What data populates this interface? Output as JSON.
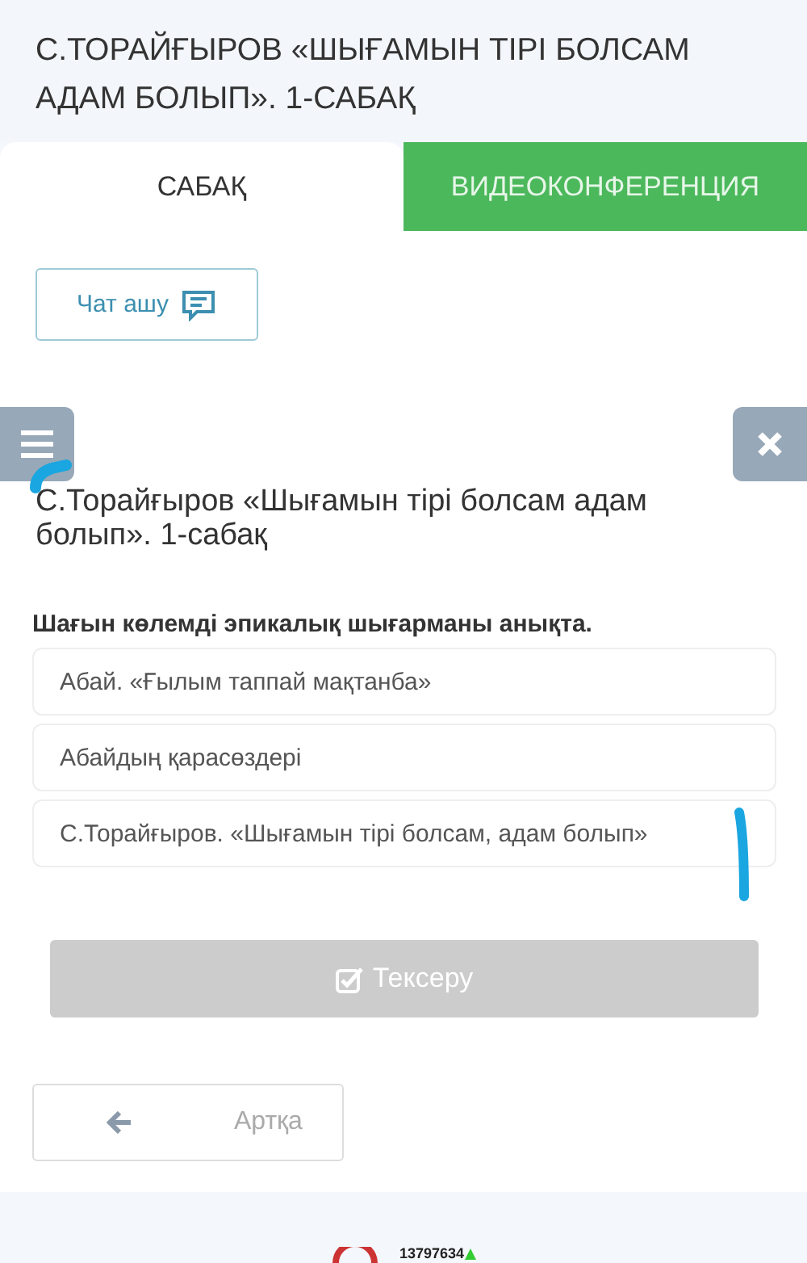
{
  "header": {
    "title": "С.ТОРАЙҒЫРОВ «ШЫҒАМЫН ТІРІ БОЛСАМ АДАМ БОЛЫП». 1-САБАҚ"
  },
  "tabs": [
    {
      "label": "САБАҚ",
      "selected": true
    },
    {
      "label": "ВИДЕОКОНФЕРЕНЦИЯ",
      "selected": false
    }
  ],
  "chat_button": {
    "label": "Чат ашу"
  },
  "lesson": {
    "title": "С.Торайғыров «Шығамын тірі болсам адам болып». 1-сабақ",
    "question": "Шағын көлемді эпикалық шығарманы анықта.",
    "options": [
      {
        "text": "Абай. «Ғылым таппай мақтанба»",
        "selected": false
      },
      {
        "text": "Абайдың қарасөздері",
        "selected": false
      },
      {
        "text": "С.Торайғыров. «Шығамын тірі болсам, адам болып»",
        "selected": false
      }
    ]
  },
  "check_button": {
    "label": "Тексеру",
    "disabled": true
  },
  "back_button": {
    "label": "Артқа"
  },
  "footer": {
    "counter": "13797634"
  }
}
